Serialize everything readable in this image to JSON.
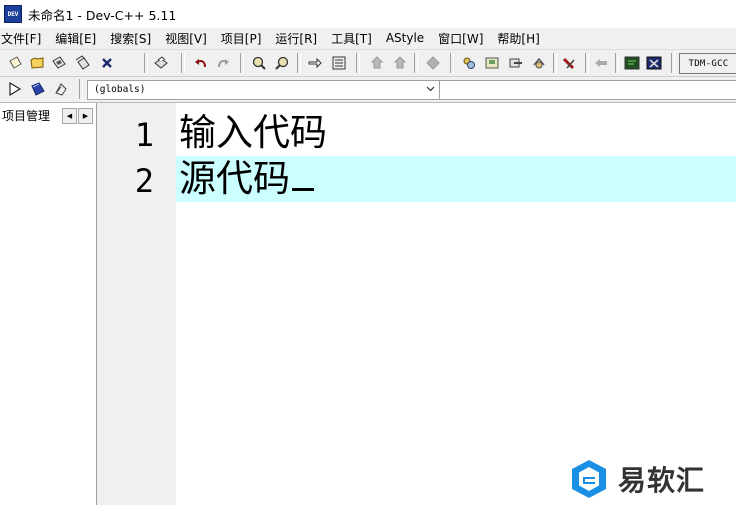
{
  "window": {
    "title": "未命名1 - Dev-C++ 5.11",
    "icon": "devcpp-app-icon",
    "icon_text": "DEV"
  },
  "menu": [
    {
      "label": "文件[F]"
    },
    {
      "label": "编辑[E]"
    },
    {
      "label": "搜索[S]"
    },
    {
      "label": "视图[V]"
    },
    {
      "label": "项目[P]"
    },
    {
      "label": "运行[R]"
    },
    {
      "label": "工具[T]"
    },
    {
      "label": "AStyle"
    },
    {
      "label": "窗口[W]"
    },
    {
      "label": "帮助[H]"
    }
  ],
  "toolbar": {
    "compiler": "TDM-GCC",
    "icons": [
      "new-file-icon",
      "open-folder-icon",
      "save-icon",
      "save-all-icon",
      "close-file-icon",
      "print-icon",
      "undo-icon",
      "redo-icon",
      "find-icon",
      "replace-icon",
      "goto-line-icon",
      "toggle-bookmark-icon",
      "indent-icon",
      "unindent-icon",
      "compile-icon",
      "new-project-icon",
      "class-browser-icon",
      "project-options-icon",
      "debug-icon",
      "profile-icon",
      "exit-icon",
      "console-icon",
      "about-icon"
    ]
  },
  "toolbar2": {
    "icons": [
      "run-icon",
      "compile-run-icon",
      "rebuild-icon"
    ],
    "scope_value": "(globals)"
  },
  "left_panel": {
    "tab_label": "项目管理"
  },
  "editor": {
    "lines": [
      {
        "number": "1",
        "text": "输入代码"
      },
      {
        "number": "2",
        "text": "源代码"
      }
    ],
    "current_line": 2,
    "highlight_color": "#ccffff"
  },
  "watermark": {
    "text": "易软汇",
    "logo": "yiruanhui-logo"
  }
}
